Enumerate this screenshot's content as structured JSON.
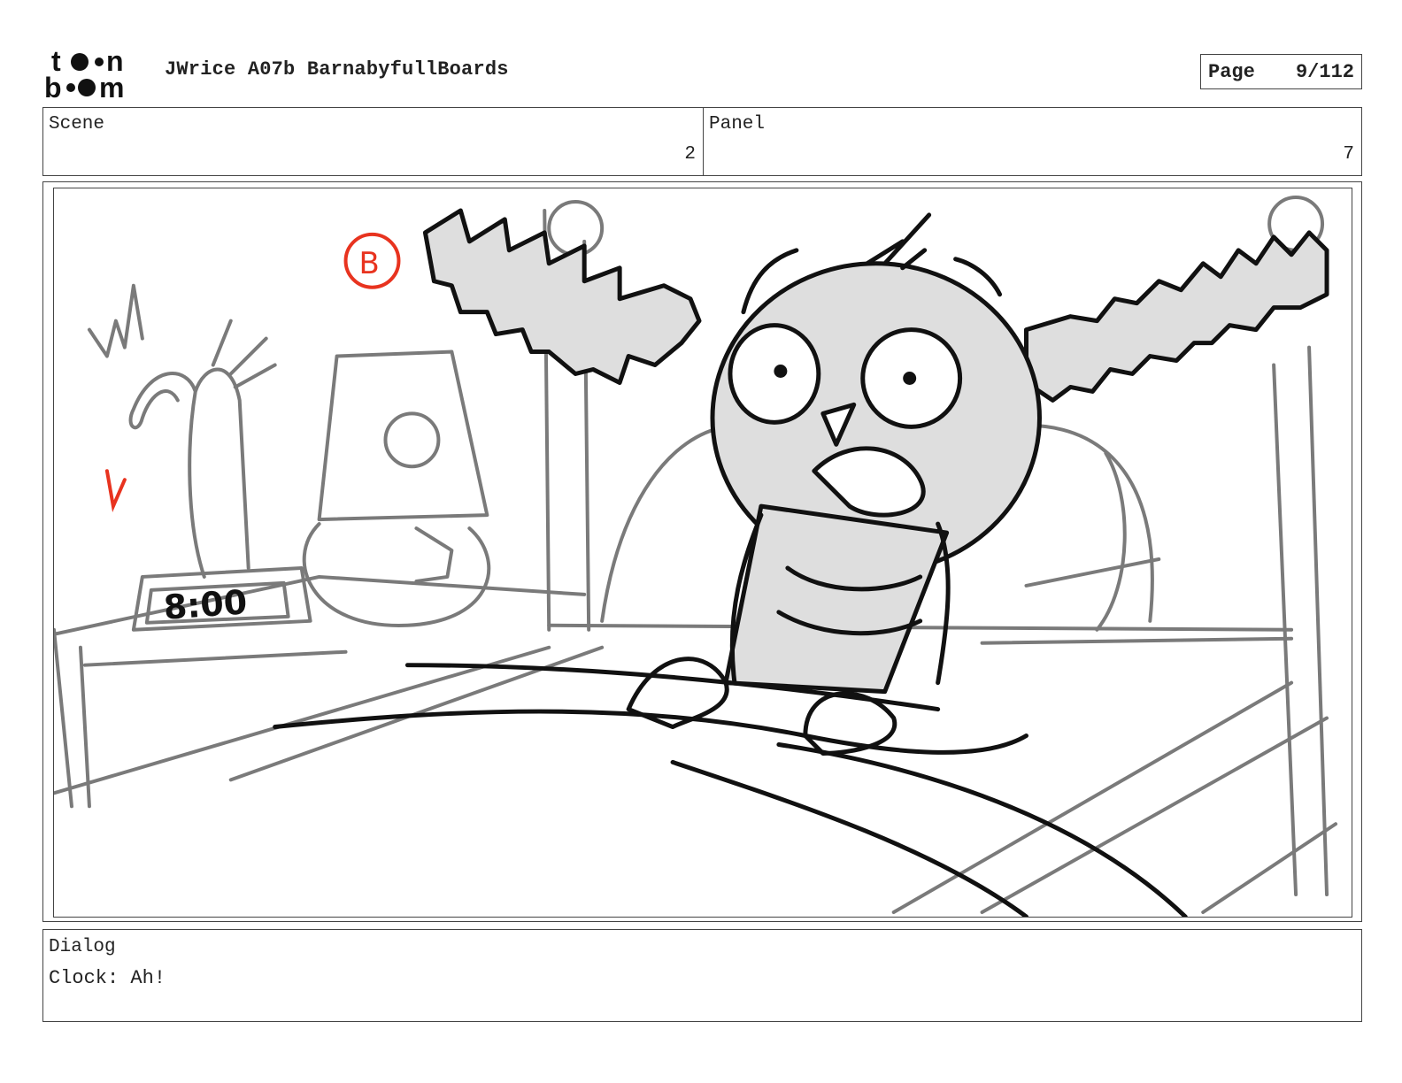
{
  "header": {
    "logo_text_top": "toon",
    "logo_text_bottom": "boom",
    "document_title": "JWrice A07b BarnabyfullBoards",
    "page_label": "Page",
    "page_number": "9/112"
  },
  "info": {
    "scene_label": "Scene",
    "scene_value": "2",
    "panel_label": "Panel",
    "panel_value": "7"
  },
  "drawing": {
    "clock_display": "8:00",
    "marker_letter": "B",
    "accent_color": "#e8331f"
  },
  "dialog": {
    "label": "Dialog",
    "text": "Clock: Ah!"
  }
}
